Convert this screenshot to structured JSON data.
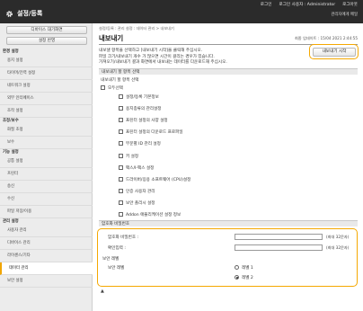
{
  "header": {
    "user_links": [
      "로그인",
      "로그인 사용자 : Administrator",
      "로그아웃"
    ],
    "app_title": "설정/등록",
    "status_link": "관리자에게 메일"
  },
  "sidebar": {
    "buttons": [
      "디바이스 대기화면",
      "설정 반영"
    ],
    "entries": [
      {
        "kind": "cat",
        "label": "환경 설정",
        "name": "sidebar-category-environment"
      },
      {
        "kind": "item",
        "label": "용지 설정",
        "name": "sidebar-item-paper"
      },
      {
        "kind": "item",
        "label": "타이머/전력 설정",
        "name": "sidebar-item-timer-power"
      },
      {
        "kind": "item",
        "label": "네트워크 설정",
        "name": "sidebar-item-network"
      },
      {
        "kind": "item",
        "label": "외부 인터페이스",
        "name": "sidebar-item-external-interface"
      },
      {
        "kind": "item",
        "label": "조작 설정",
        "name": "sidebar-item-operation"
      },
      {
        "kind": "cat",
        "label": "조정/보수",
        "name": "sidebar-category-adjustment"
      },
      {
        "kind": "item",
        "label": "화질 조정",
        "name": "sidebar-item-image-quality"
      },
      {
        "kind": "item",
        "label": "보수",
        "name": "sidebar-item-maintenance"
      },
      {
        "kind": "cat",
        "label": "기능 설정",
        "name": "sidebar-category-function"
      },
      {
        "kind": "item",
        "label": "공통 설정",
        "name": "sidebar-item-common"
      },
      {
        "kind": "item",
        "label": "프린터",
        "name": "sidebar-item-printer"
      },
      {
        "kind": "item",
        "label": "송신",
        "name": "sidebar-item-send"
      },
      {
        "kind": "item",
        "label": "수신",
        "name": "sidebar-item-receive"
      },
      {
        "kind": "item",
        "label": "파일 저장/이용",
        "name": "sidebar-item-file-storage"
      },
      {
        "kind": "cat",
        "label": "관리 설정",
        "name": "sidebar-category-management"
      },
      {
        "kind": "item",
        "label": "사용자 관리",
        "name": "sidebar-item-user-management"
      },
      {
        "kind": "item",
        "label": "디바이스 관리",
        "name": "sidebar-item-device-management"
      },
      {
        "kind": "item",
        "label": "라이센스/기타",
        "name": "sidebar-item-license"
      },
      {
        "kind": "item",
        "label": "데이터 관리",
        "name": "sidebar-item-data-management",
        "active": true
      },
      {
        "kind": "item",
        "label": "보안 설정",
        "name": "sidebar-item-security"
      }
    ]
  },
  "main": {
    "breadcrumb": "설정/등록 : 관리 설정 : 데이터 관리 > 내보내기",
    "title": "내보내기",
    "updated": "최종 업데이트 : 15/04 2021 2:44:55",
    "description_lines": [
      "내보낼 항목을 선택하고 [내보내기 시작]을 클릭해 주십시오.",
      "파일 크기/내보내기 개수 가 많으면 시간이 걸리는 경우가 있습니다.",
      "가져오기/내보내기 결과 화면에서 내보내는 데이터를 다운로드해 주십시오."
    ],
    "export_button": "내보내기 시작",
    "items_section": "내보내기 할 항목 선택",
    "items_subhead": "내보내기 할 항목 선택",
    "select_all": "모두선택",
    "items": [
      "설정/등록 기본정보",
      "용지종류의 관리설정",
      "프린터 설정의 사양 설정",
      "프린터 설정의 다운로드 프로파일",
      "부문별 ID 관리 설정",
      "키 설정",
      "팩스/I-팩스 설정",
      "드라이버/응용 소프트웨어 (CPU)설정",
      "인증 사용자 관리",
      "보안 폴리시 설정",
      "Addon 애플리케이션 설정 정보"
    ],
    "password_section": "암호화 비밀번호",
    "password_label": "암호화 비밀번호 :",
    "confirm_label": "확인입력 :",
    "max_hint": "(최대 32문자)",
    "security_subhead": "보안 레벨",
    "security_label": "보안 레벨",
    "levels": [
      "레벨 1",
      "레벨 2"
    ],
    "selected_level": 1,
    "top_link": "▲"
  }
}
